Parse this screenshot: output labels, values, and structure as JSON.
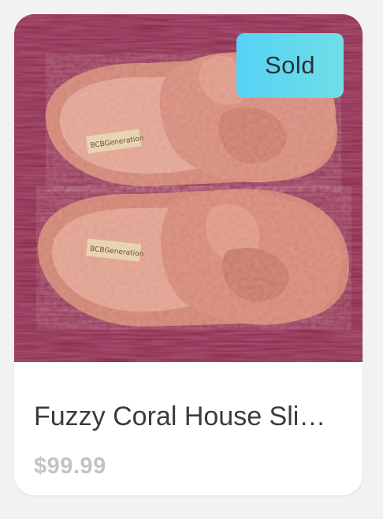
{
  "card": {
    "badge": "Sold",
    "title": "Fuzzy Coral House Slippers",
    "price": "$99.99",
    "image": {
      "insole_label": "BCBGeneration"
    }
  },
  "colors": {
    "badge_start": "#56d2f7",
    "badge_end": "#6fdfe6",
    "price": "#c3c3c7",
    "title": "#3a3b3f",
    "rug": "#8b2a4e",
    "slipper": "#d68a7c"
  }
}
